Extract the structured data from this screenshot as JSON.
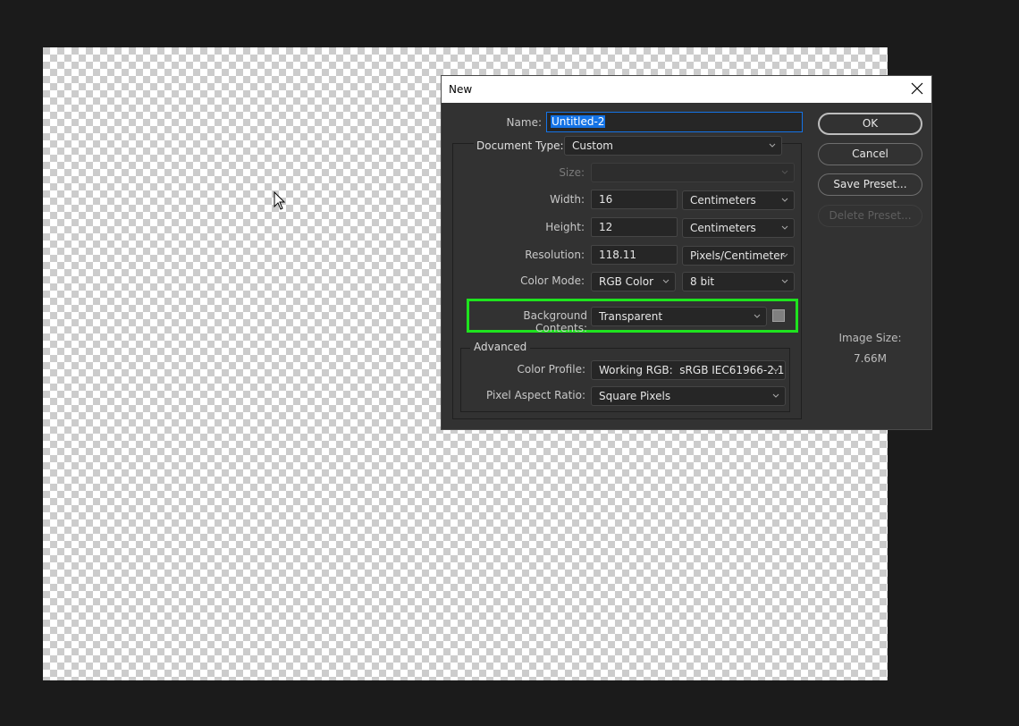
{
  "dialog": {
    "title": "New",
    "name": {
      "label": "Name:",
      "value": "Untitled-2"
    },
    "document_type": {
      "label": "Document Type:",
      "value": "Custom"
    },
    "size": {
      "label": "Size:",
      "value": ""
    },
    "width": {
      "label": "Width:",
      "value": "16",
      "unit": "Centimeters"
    },
    "height": {
      "label": "Height:",
      "value": "12",
      "unit": "Centimeters"
    },
    "resolution": {
      "label": "Resolution:",
      "value": "118.11",
      "unit": "Pixels/Centimeter"
    },
    "color_mode": {
      "label": "Color Mode:",
      "value": "RGB Color",
      "depth": "8 bit"
    },
    "background_contents": {
      "label": "Background Contents:",
      "value": "Transparent",
      "swatch_color": "#808080"
    },
    "advanced": {
      "title": "Advanced",
      "color_profile": {
        "label": "Color Profile:",
        "value": "Working RGB:  sRGB IEC61966-2.1"
      },
      "pixel_aspect_ratio": {
        "label": "Pixel Aspect Ratio:",
        "value": "Square Pixels"
      }
    },
    "buttons": {
      "ok": "OK",
      "cancel": "Cancel",
      "save_preset": "Save Preset...",
      "delete_preset": "Delete Preset..."
    },
    "image_size": {
      "label": "Image Size:",
      "value": "7.66M"
    }
  },
  "highlight_color": "#1ee31e"
}
